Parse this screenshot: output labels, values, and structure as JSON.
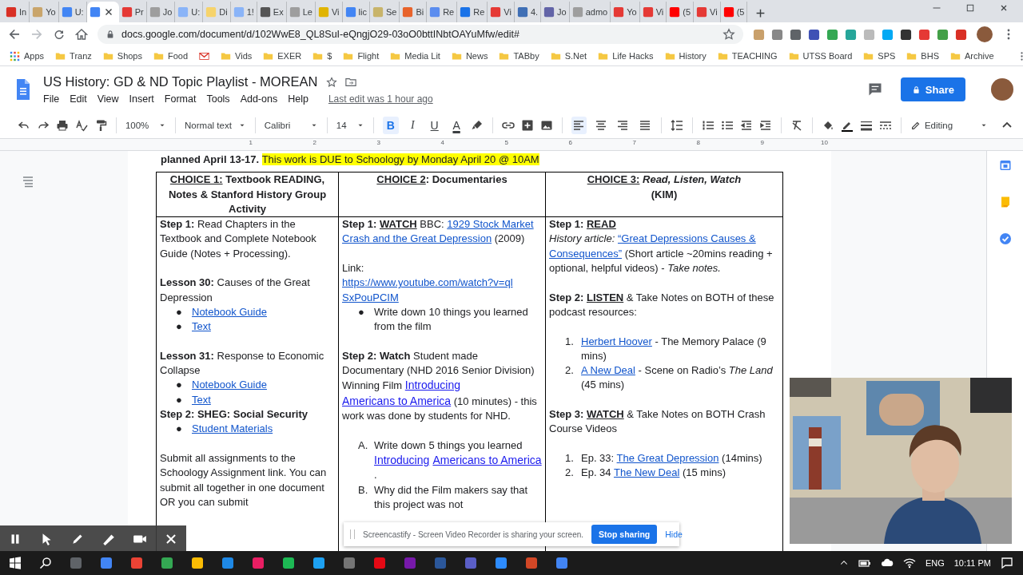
{
  "browser": {
    "tabs": [
      {
        "title": "In",
        "color": "#d93025",
        "selected": false
      },
      {
        "title": "Yo",
        "color": "#c9a56b",
        "selected": false
      },
      {
        "title": "U:",
        "color": "#4285f4",
        "selected": false
      },
      {
        "color": "#4285f4",
        "selected": true
      },
      {
        "title": "Pr",
        "color": "#e53935",
        "selected": false
      },
      {
        "title": "Jo",
        "color": "#9e9e9e",
        "selected": false
      },
      {
        "title": "U:",
        "color": "#8ab4f8",
        "selected": false
      },
      {
        "title": "Di",
        "color": "#f6d36b",
        "selected": false
      },
      {
        "title": "1!",
        "color": "#8ab4f8",
        "selected": false
      },
      {
        "title": "Ex",
        "color": "#555555",
        "selected": false
      },
      {
        "title": "Le",
        "color": "#9e9e9e",
        "selected": false
      },
      {
        "title": "Vi",
        "color": "#e0b400",
        "selected": false
      },
      {
        "title": "lic",
        "color": "#4285f4",
        "selected": false
      },
      {
        "title": "Se",
        "color": "#c8b46a",
        "selected": false
      },
      {
        "title": "Bi",
        "color": "#e8632b",
        "selected": false
      },
      {
        "title": "Re",
        "color": "#5b8def",
        "selected": false
      },
      {
        "title": "Re",
        "color": "#1a73e8",
        "selected": false
      },
      {
        "title": "Vi",
        "color": "#e53935",
        "selected": false
      },
      {
        "title": "4.",
        "color": "#3f6fb5",
        "selected": false
      },
      {
        "title": "Jo",
        "color": "#6264a7",
        "selected": false
      },
      {
        "title": "admo",
        "color": "#9e9e9e",
        "selected": false
      },
      {
        "title": "Yo",
        "color": "#e53935",
        "selected": false
      },
      {
        "title": "Vi",
        "color": "#e53935",
        "selected": false
      },
      {
        "title": "(5",
        "color": "#ff0000",
        "selected": false
      },
      {
        "title": "Vi",
        "color": "#e53935",
        "selected": false
      },
      {
        "title": "(5",
        "color": "#ff0000",
        "selected": false
      }
    ],
    "url": "docs.google.com/document/d/102WwE8_QL8SuI-eQngjO29-03oO0bttINbtOAYuMfw/edit#",
    "bookmarks": [
      {
        "label": "Apps",
        "kind": "apps"
      },
      {
        "label": "Tranz",
        "kind": "folder"
      },
      {
        "label": "Shops",
        "kind": "folder"
      },
      {
        "label": "Food",
        "kind": "folder"
      },
      {
        "kind": "mail"
      },
      {
        "label": "Vids",
        "kind": "folder"
      },
      {
        "label": "EXER",
        "kind": "folder"
      },
      {
        "label": "$",
        "kind": "folder"
      },
      {
        "label": "Flight",
        "kind": "folder"
      },
      {
        "label": "Media Lit",
        "kind": "folder"
      },
      {
        "label": "News",
        "kind": "folder"
      },
      {
        "label": "TABby",
        "kind": "folder"
      },
      {
        "label": "S.Net",
        "kind": "folder"
      },
      {
        "label": "Life Hacks",
        "kind": "folder"
      },
      {
        "label": "History",
        "kind": "folder"
      },
      {
        "label": "TEACHING",
        "kind": "folder"
      },
      {
        "label": "UTSS Board",
        "kind": "folder"
      },
      {
        "label": "SPS",
        "kind": "folder"
      },
      {
        "label": "BHS",
        "kind": "folder"
      },
      {
        "label": "Archive",
        "kind": "folder"
      }
    ]
  },
  "docs": {
    "title": "US History: GD & ND Topic Playlist - MOREAN",
    "menus": [
      "File",
      "Edit",
      "View",
      "Insert",
      "Format",
      "Tools",
      "Add-ons",
      "Help"
    ],
    "last_edit": "Last edit was 1 hour ago",
    "share": "Share",
    "toolbar": {
      "zoom": "100%",
      "style": "Normal text",
      "font": "Calibri",
      "size": "14",
      "format": [
        {
          "label": "B",
          "selected": true
        },
        {
          "label": "I",
          "selected": false
        },
        {
          "label": "U",
          "selected": false
        },
        {
          "label": "A",
          "selected": false
        }
      ],
      "align": [
        {
          "selected": true
        },
        {
          "selected": false
        },
        {
          "selected": false
        },
        {
          "selected": false
        }
      ],
      "mode": "Editing"
    },
    "ruler": [
      "1",
      "2",
      "3",
      "4",
      "5",
      "6",
      "7",
      "8",
      "9",
      "10"
    ]
  },
  "document": {
    "intro": [
      {
        "text": "planned April 13-17. ",
        "kind": "bold"
      },
      {
        "text": "This work is DUE to Schoology by Monday April 20 @ 10AM",
        "kind": "highlight"
      }
    ],
    "table": {
      "headers": [
        [
          {
            "text": "CHOICE 1:",
            "kind": "bold-underline"
          },
          {
            "text": " Textbook READING, Notes & Stanford History Group Activity",
            "kind": "bold"
          }
        ],
        [
          {
            "text": "CHOICE 2",
            "kind": "bold-underline"
          },
          {
            "text": ": Documentaries",
            "kind": "bold"
          }
        ],
        [
          {
            "text": "CHOICE 3:",
            "kind": "bold-underline"
          },
          {
            "text": " Read, Listen, Watch",
            "kind": "bold-italic"
          },
          {
            "text": "(KIM)",
            "kind": "bold-line"
          }
        ]
      ],
      "columns": [
        [
          {
            "kind": "para",
            "space": false,
            "spans": [
              {
                "text": "Step 1:",
                "kind": "bold"
              },
              {
                "text": " Read Chapters in the Textbook and Complete Notebook Guide (Notes + Processing).",
                "kind": "plain"
              }
            ]
          },
          {
            "kind": "para",
            "space": true,
            "spans": [
              {
                "text": "Lesson 30:",
                "kind": "bold"
              },
              {
                "text": " Causes of the Great Depression",
                "kind": "plain"
              }
            ]
          },
          {
            "kind": "item",
            "marker": "●",
            "space": false,
            "spans": [
              {
                "text": "Notebook Guide",
                "kind": "link"
              }
            ]
          },
          {
            "kind": "item",
            "marker": "●",
            "space": false,
            "spans": [
              {
                "text": "Text",
                "kind": "link"
              }
            ]
          },
          {
            "kind": "para",
            "space": true,
            "spans": [
              {
                "text": "Lesson 31:",
                "kind": "bold"
              },
              {
                "text": " Response to Economic Collapse",
                "kind": "plain"
              }
            ]
          },
          {
            "kind": "item",
            "marker": "●",
            "space": false,
            "spans": [
              {
                "text": "Notebook Guide",
                "kind": "link"
              }
            ]
          },
          {
            "kind": "item",
            "marker": "●",
            "space": false,
            "spans": [
              {
                "text": "Text",
                "kind": "link"
              }
            ]
          },
          {
            "kind": "para",
            "space": false,
            "spans": [
              {
                "text": "Step 2: SHEG: Social Security",
                "kind": "bold"
              }
            ]
          },
          {
            "kind": "item",
            "marker": "●",
            "space": false,
            "spans": [
              {
                "text": "Student Materials",
                "kind": "link"
              }
            ]
          },
          {
            "kind": "para",
            "space": true,
            "spans": [
              {
                "text": "Submit all assignments to the Schoology Assignment link. You can submit all together in one document OR you can submit",
                "kind": "plain"
              }
            ]
          }
        ],
        [
          {
            "kind": "para",
            "space": false,
            "spans": [
              {
                "text": "Step 1: ",
                "kind": "bold"
              },
              {
                "text": "WATCH",
                "kind": "bold-underline"
              },
              {
                "text": " BBC: ",
                "kind": "plain"
              },
              {
                "text": "1929 Stock Market",
                "kind": "link"
              },
              {
                "text": "Crash and the Great Depression",
                "kind": "link"
              },
              {
                "text": " (2009)",
                "kind": "plain"
              }
            ]
          },
          {
            "kind": "para",
            "space": true,
            "spans": [
              {
                "text": "Link:",
                "kind": "plain"
              }
            ]
          },
          {
            "kind": "para",
            "space": false,
            "spans": [
              {
                "text": "https://www.youtube.com/watch?v=ql",
                "kind": "link"
              },
              {
                "text": "SxPouPCIM",
                "kind": "link"
              }
            ]
          },
          {
            "kind": "item",
            "marker": "●",
            "space": false,
            "spans": [
              {
                "text": "Write down 10 things you learned from the film",
                "kind": "plain"
              }
            ]
          },
          {
            "kind": "para",
            "space": true,
            "spans": [
              {
                "text": "Step 2:  Watch",
                "kind": "bold"
              },
              {
                "text": " Student made Documentary (NHD 2016 Senior Division) Winning Film ",
                "kind": "plain"
              },
              {
                "text": "Introducing",
                "kind": "link-bright"
              },
              {
                "text": "Americans to America",
                "kind": "link-bright"
              },
              {
                "text": " (10 minutes) - this work was done by students for NHD.",
                "kind": "plain"
              }
            ]
          },
          {
            "kind": "item",
            "marker": "A.",
            "space": true,
            "spans": [
              {
                "text": "Write down 5 things you learned  ",
                "kind": "plain"
              },
              {
                "text": "Introducing",
                "kind": "link-bright"
              },
              {
                "text": "Americans to America",
                "kind": "link-bright"
              },
              {
                "text": ".",
                "kind": "plain"
              }
            ]
          },
          {
            "kind": "item",
            "marker": "B.",
            "space": false,
            "spans": [
              {
                "text": "Why did the Film makers say that this project was not",
                "kind": "plain"
              }
            ]
          }
        ],
        [
          {
            "kind": "para",
            "space": false,
            "spans": [
              {
                "text": "Step 1: ",
                "kind": "bold"
              },
              {
                "text": "READ",
                "kind": "bold-underline"
              }
            ]
          },
          {
            "kind": "para",
            "space": false,
            "spans": [
              {
                "text": "History article:  ",
                "kind": "italic"
              },
              {
                "text": "“Great Depressions Causes &",
                "kind": "link"
              },
              {
                "text": "Consequences”",
                "kind": "link"
              },
              {
                "text": " (Short article ~20mins reading + optional, helpful videos) - ",
                "kind": "plain"
              },
              {
                "text": "Take notes.",
                "kind": "italic"
              }
            ]
          },
          {
            "kind": "para",
            "space": true,
            "spans": [
              {
                "text": "Step 2: ",
                "kind": "bold"
              },
              {
                "text": "LISTEN",
                "kind": "bold-underline"
              },
              {
                "text": " & Take Notes on BOTH of these podcast resources:",
                "kind": "plain"
              }
            ]
          },
          {
            "kind": "item",
            "marker": "1.",
            "space": true,
            "spans": [
              {
                "text": "Herbert Hoover",
                "kind": "link"
              },
              {
                "text": " - The Memory Palace (9 mins)",
                "kind": "plain"
              }
            ]
          },
          {
            "kind": "item",
            "marker": "2.",
            "space": false,
            "spans": [
              {
                "text": "A New Deal",
                "kind": "link"
              },
              {
                "text": " - Scene on Radio’s ",
                "kind": "plain"
              },
              {
                "text": "The Land",
                "kind": "italic"
              },
              {
                "text": " (45 mins)",
                "kind": "plain"
              }
            ]
          },
          {
            "kind": "para",
            "space": true,
            "spans": [
              {
                "text": "Step 3: ",
                "kind": "bold"
              },
              {
                "text": "WATCH",
                "kind": "bold-underline"
              },
              {
                "text": " & Take Notes on BOTH Crash Course Videos",
                "kind": "plain"
              }
            ]
          },
          {
            "kind": "item",
            "marker": "1.",
            "space": true,
            "spans": [
              {
                "text": "Ep. 33: ",
                "kind": "plain"
              },
              {
                "text": "The Great Depression",
                "kind": "link"
              },
              {
                "text": " (14mins)",
                "kind": "plain"
              }
            ]
          },
          {
            "kind": "item",
            "marker": "2.",
            "space": false,
            "spans": [
              {
                "text": "Ep. 34 ",
                "kind": "plain"
              },
              {
                "text": "The New Deal",
                "kind": "link"
              },
              {
                "text": " (15 mins)",
                "kind": "plain"
              }
            ]
          }
        ]
      ]
    }
  },
  "sharing_bar": {
    "message": "Screencastify - Screen Video Recorder is sharing your screen.",
    "stop": "Stop sharing",
    "hide": "Hide"
  },
  "taskbar": {
    "language": "ENG",
    "time": "10:11 PM"
  }
}
